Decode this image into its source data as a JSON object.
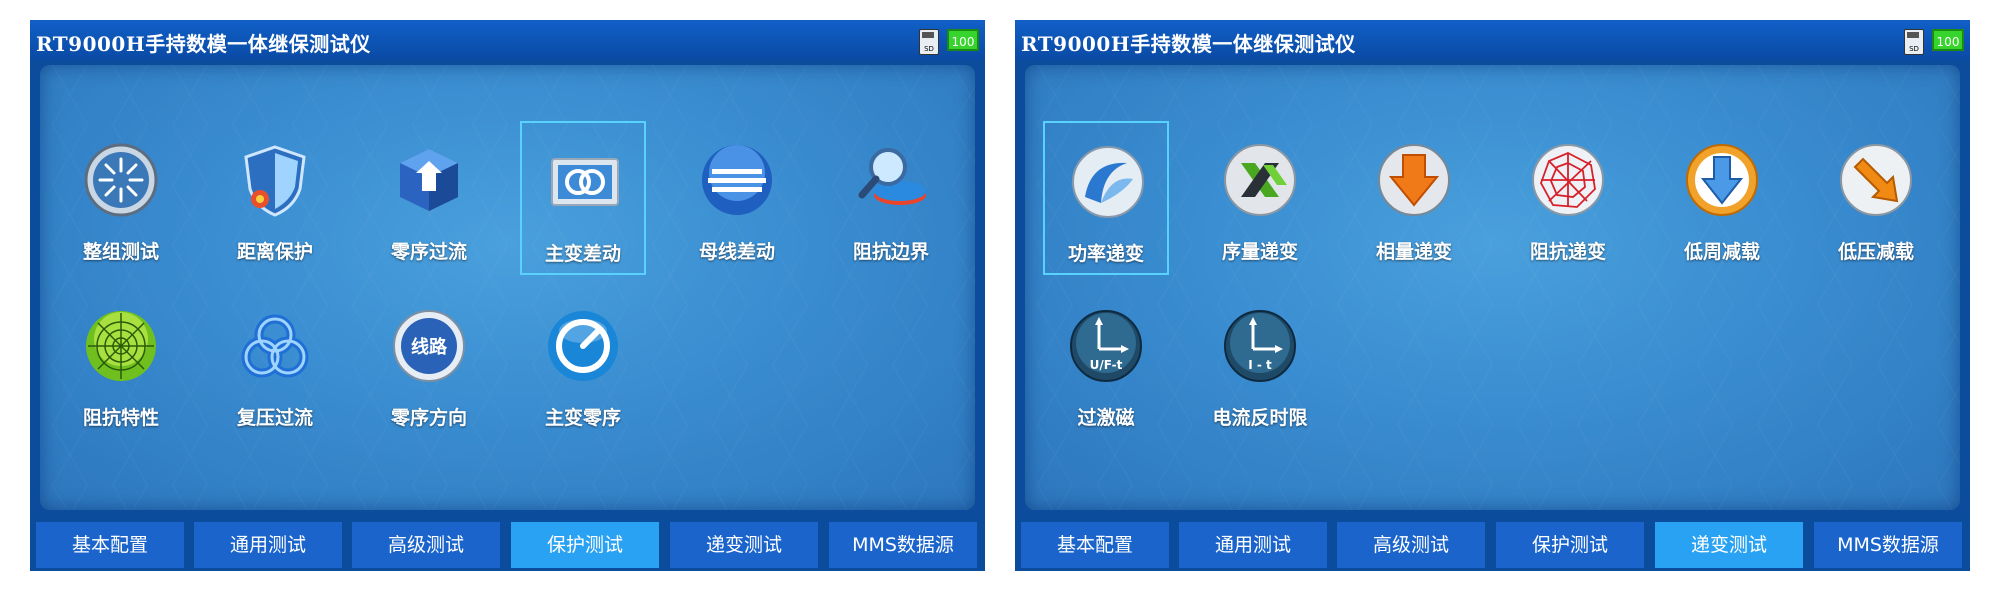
{
  "left": {
    "title": "RT9000H手持数模一体继保测试仪",
    "sd": "SD",
    "battery": "100",
    "icons": [
      {
        "label": "整组测试",
        "icon": "starburst-icon"
      },
      {
        "label": "距离保护",
        "icon": "shield-icon"
      },
      {
        "label": "零序过流",
        "icon": "cube-arrow-icon"
      },
      {
        "label": "主变差动",
        "icon": "double-ring-icon"
      },
      {
        "label": "母线差动",
        "icon": "bus-lines-icon"
      },
      {
        "label": "阻抗边界",
        "icon": "magnifier-icon"
      },
      {
        "label": "阻抗特性",
        "icon": "web-icon"
      },
      {
        "label": "复压过流",
        "icon": "knot-icon"
      },
      {
        "label": "零序方向",
        "icon": "line-badge-icon"
      },
      {
        "label": "主变零序",
        "icon": "gauge-icon"
      }
    ],
    "line_badge_text": "线路",
    "selected_index": 3,
    "tabs": [
      "基本配置",
      "通用测试",
      "高级测试",
      "保护测试",
      "递变测试",
      "MMS数据源"
    ],
    "active_tab": 3
  },
  "right": {
    "title": "RT9000H手持数模一体继保测试仪",
    "sd": "SD",
    "battery": "100",
    "icons": [
      {
        "label": "功率递变",
        "icon": "swirl-icon"
      },
      {
        "label": "序量递变",
        "icon": "x-arrows-icon"
      },
      {
        "label": "相量递变",
        "icon": "down-arrow-orange-icon"
      },
      {
        "label": "阻抗递变",
        "icon": "red-web-icon"
      },
      {
        "label": "低周减载",
        "icon": "down-arrow-blue-icon"
      },
      {
        "label": "低压减载",
        "icon": "diagonal-arrow-icon"
      },
      {
        "label": "过激磁",
        "icon": "uf-t-icon"
      },
      {
        "label": "电流反时限",
        "icon": "i-t-icon"
      }
    ],
    "uft_text": "U/F-t",
    "it_text": "I - t",
    "selected_index": 0,
    "tabs": [
      "基本配置",
      "通用测试",
      "高级测试",
      "保护测试",
      "递变测试",
      "MMS数据源"
    ],
    "active_tab": 4
  },
  "colors": {
    "accent": "#2aa2f4",
    "tab": "#1a64cc",
    "frame": "#0b4d9c",
    "battery": "#36d42c"
  }
}
